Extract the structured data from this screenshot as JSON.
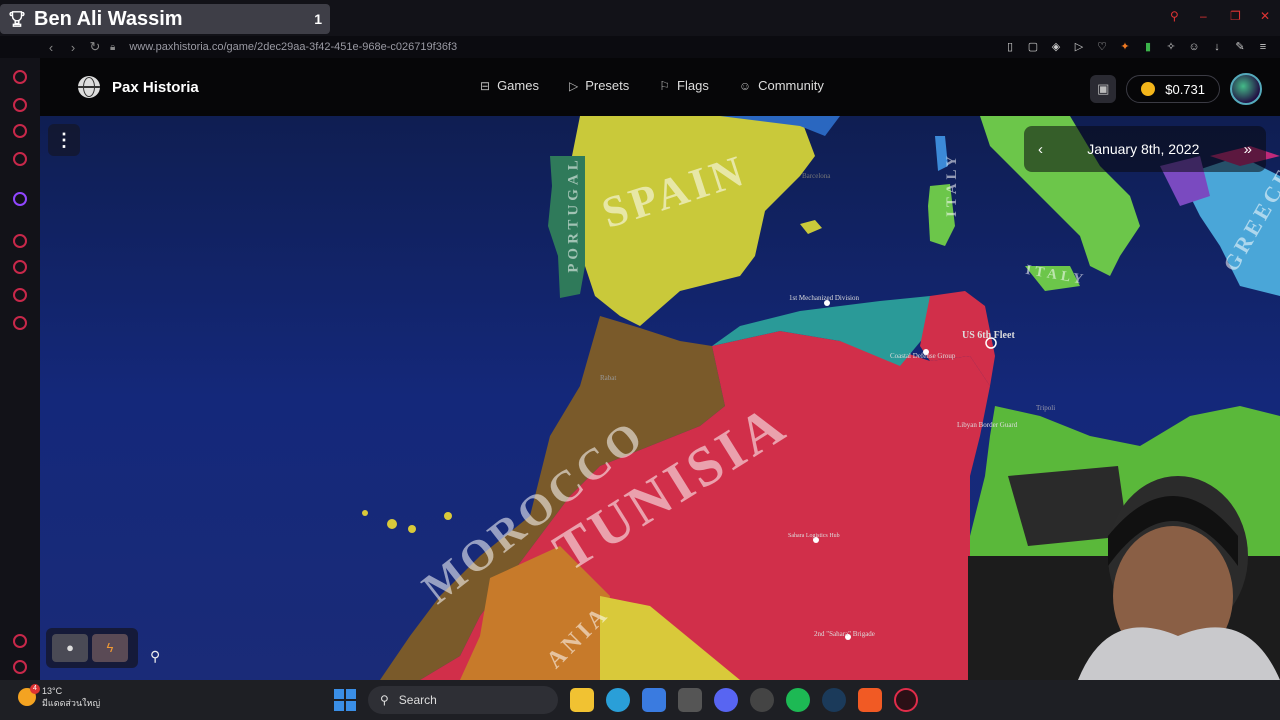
{
  "stream": {
    "name": "Ben Ali Wassim",
    "count": "1"
  },
  "browser": {
    "url": "www.paxhistoria.co/game/2dec29aa-3f42-451e-968e-c026719f36f3"
  },
  "header": {
    "brand": "Pax Historia",
    "nav": [
      {
        "label": "Games",
        "icon": "gamepad-icon"
      },
      {
        "label": "Presets",
        "icon": "play-icon"
      },
      {
        "label": "Flags",
        "icon": "flag-icon"
      },
      {
        "label": "Community",
        "icon": "community-icon"
      }
    ],
    "balance": "$0.731"
  },
  "map": {
    "date": "January 8th, 2022",
    "countries": {
      "spain": "SPAIN",
      "portugal": "PORTUGAL",
      "morocco": "MOROCCO",
      "tunisia": "TUNISIA",
      "italy": "ITALY",
      "italy2": "ITALY",
      "greece": "GREECE",
      "mauritania_partial": "ANIA"
    },
    "units": {
      "u1": "1st Mechanized Division",
      "u2": "Coastal Defense Group",
      "u3": "US 6th Fleet",
      "u4": "Libyan Border Guard",
      "u5": "Sahara Logistics Hub",
      "u6": "2nd \"Sahara\" Brigade"
    },
    "cities": {
      "c1": "Barcelona",
      "c2": "Rabat",
      "c3": "Tripoli"
    }
  },
  "taskbar": {
    "temperature": "13°C",
    "weather": "มีแดดส่วนใหญ่",
    "search": "Search",
    "weather_badge": "4"
  }
}
